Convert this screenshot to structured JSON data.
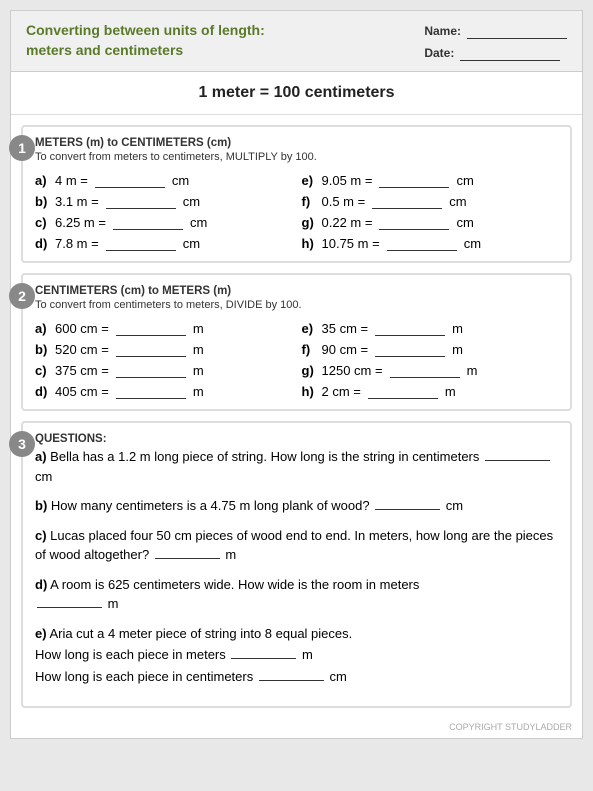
{
  "header": {
    "title_line1": "Converting between units of length:",
    "title_line2": "meters and centimeters",
    "name_label": "Name:",
    "date_label": "Date:"
  },
  "key_fact": "1 meter = 100 centimeters",
  "section1": {
    "number": "1",
    "title": "METERS (m) to CENTIMETERS (cm)",
    "subtitle": "To convert from meters to centimeters, MULTIPLY by 100.",
    "problems": [
      {
        "label": "a)",
        "question": "4 m =",
        "unit": "cm"
      },
      {
        "label": "e)",
        "question": "9.05 m =",
        "unit": "cm"
      },
      {
        "label": "b)",
        "question": "3.1 m =",
        "unit": "cm"
      },
      {
        "label": "f)",
        "question": "0.5 m =",
        "unit": "cm"
      },
      {
        "label": "c)",
        "question": "6.25 m =",
        "unit": "cm"
      },
      {
        "label": "g)",
        "question": "0.22 m =",
        "unit": "cm"
      },
      {
        "label": "d)",
        "question": "7.8 m =",
        "unit": "cm"
      },
      {
        "label": "h)",
        "question": "10.75 m =",
        "unit": "cm"
      }
    ]
  },
  "section2": {
    "number": "2",
    "title": "CENTIMETERS (cm) to METERS (m)",
    "subtitle": "To convert from centimeters to meters, DIVIDE by 100.",
    "problems": [
      {
        "label": "a)",
        "question": "600 cm =",
        "unit": "m"
      },
      {
        "label": "e)",
        "question": "35 cm =",
        "unit": "m"
      },
      {
        "label": "b)",
        "question": "520 cm =",
        "unit": "m"
      },
      {
        "label": "f)",
        "question": "90 cm =",
        "unit": "m"
      },
      {
        "label": "c)",
        "question": "375 cm =",
        "unit": "m"
      },
      {
        "label": "g)",
        "question": "1250 cm  =",
        "unit": "m"
      },
      {
        "label": "d)",
        "question": "405 cm =",
        "unit": "m"
      },
      {
        "label": "h)",
        "question": "2 cm =",
        "unit": "m"
      }
    ]
  },
  "section3": {
    "number": "3",
    "title": "QUESTIONS:",
    "questions": [
      {
        "label": "a)",
        "text_before": "Bella has a 1.2 m long piece of string. How long is the string in centimeters",
        "unit": "cm"
      },
      {
        "label": "b)",
        "text_before": "How many centimeters is a 4.75 m long plank of wood?",
        "unit": "cm"
      },
      {
        "label": "c)",
        "text_before": "Lucas placed four 50 cm pieces of wood end to end. In meters, how long are the pieces of wood altogether?",
        "unit": "m"
      },
      {
        "label": "d)",
        "text_before": "A room is 625 centimeters wide. How wide is the room in meters",
        "unit": "m"
      },
      {
        "label": "e)",
        "text_part1": "Aria cut a 4 meter piece of string into 8 equal pieces.",
        "text_part2": "How long is each piece in meters",
        "unit1": "m",
        "text_part3": "How long is each piece in centimeters",
        "unit2": "cm"
      }
    ]
  },
  "copyright": "COPYRIGHT STUDYLADDER"
}
